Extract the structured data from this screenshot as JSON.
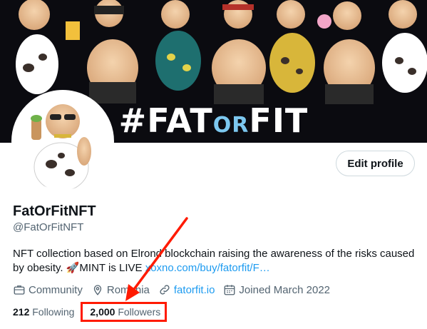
{
  "banner": {
    "title_part1": "#FAT",
    "title_part2": "OR",
    "title_part3": "FIT"
  },
  "profile": {
    "name": "FatOrFitNFT",
    "handle": "@FatOrFitNFT",
    "bio_text": "NFT collection based on Elrond blockchain raising the awareness of the risks caused by obesity. 🚀MINT is LIVE ",
    "bio_link": "xoxno.com/buy/fatorfit/F…",
    "edit_button_label": "Edit profile"
  },
  "meta": {
    "category": "Community",
    "location": "Romania",
    "website": "fatorfit.io",
    "joined": "Joined March 2022"
  },
  "stats": {
    "following_count": "212",
    "following_label": "Following",
    "followers_count": "2,000",
    "followers_label": "Followers"
  },
  "colors": {
    "link": "#1d9bf0",
    "muted": "#536471",
    "highlight": "#ff1a00"
  },
  "icons": [
    "briefcase-icon",
    "location-pin-icon",
    "link-icon",
    "calendar-icon"
  ]
}
